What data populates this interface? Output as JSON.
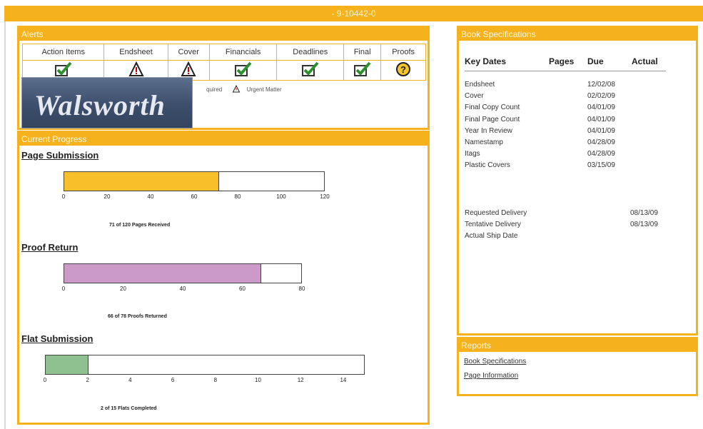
{
  "header": {
    "title": "- 9-10442-0"
  },
  "alerts": {
    "title": "Alerts",
    "columns": [
      "Action Items",
      "Endsheet",
      "Cover",
      "Financials",
      "Deadlines",
      "Final",
      "Proofs"
    ],
    "icons": [
      "check-icon",
      "warning-icon",
      "warning-icon",
      "check-icon",
      "check-icon",
      "check-icon",
      "question-icon"
    ],
    "legend_required": "quired",
    "legend_urgent": "Urgent Matter"
  },
  "logo": {
    "text": "Walsworth"
  },
  "progress": {
    "title": "Current Progress",
    "bars": [
      {
        "title": "Page Submission",
        "ticks": [
          "0",
          "20",
          "40",
          "60",
          "80",
          "100",
          "120"
        ],
        "max": 120,
        "value": 71,
        "color": "#f7c02a",
        "caption": "71 of 120 Pages Received"
      },
      {
        "title": "Proof Return",
        "ticks": [
          "0",
          "20",
          "40",
          "60",
          "80"
        ],
        "max": 78,
        "value": 66,
        "color": "#cc9ac8",
        "caption": "66 of 78 Proofs Returned"
      },
      {
        "title": "Flat Submission",
        "ticks": [
          "0",
          "2",
          "4",
          "6",
          "8",
          "10",
          "12",
          "14"
        ],
        "max": 15,
        "value": 2,
        "color": "#8fc08f",
        "caption": "2 of 15 Flats Completed"
      }
    ]
  },
  "specs": {
    "title": "Book Specifications",
    "headers": {
      "key": "Key Dates",
      "pages": "Pages",
      "due": "Due",
      "actual": "Actual"
    },
    "rows": [
      {
        "k": "Endsheet",
        "d": "12/02/08",
        "a": ""
      },
      {
        "k": "Cover",
        "d": "02/02/09",
        "a": ""
      },
      {
        "k": "Final Copy Count",
        "d": "04/01/09",
        "a": ""
      },
      {
        "k": "Final Page Count",
        "d": "04/01/09",
        "a": ""
      },
      {
        "k": "Year In Review",
        "d": "04/01/09",
        "a": ""
      },
      {
        "k": "Namestamp",
        "d": "04/28/09",
        "a": ""
      },
      {
        "k": "Itags",
        "d": "04/28/09",
        "a": ""
      },
      {
        "k": "Plastic Covers",
        "d": "03/15/09",
        "a": ""
      }
    ],
    "delivery": [
      {
        "k": "Requested Delivery",
        "d": "",
        "a": "08/13/09"
      },
      {
        "k": "Tentative Delivery",
        "d": "",
        "a": "08/13/09"
      },
      {
        "k": "Actual Ship Date",
        "d": "",
        "a": ""
      }
    ]
  },
  "reports": {
    "title": "Reports",
    "links": [
      "Book Specifications",
      "Page Information"
    ]
  },
  "colors": {
    "accent": "#f6b21c"
  }
}
